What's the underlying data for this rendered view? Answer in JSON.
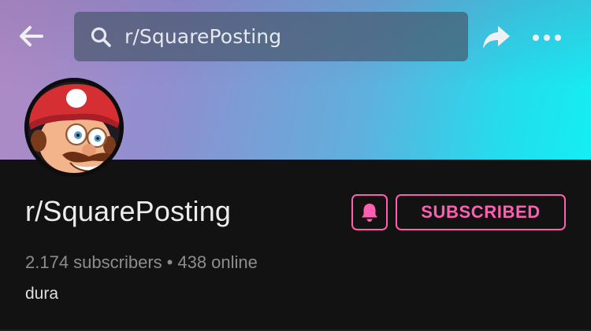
{
  "header": {
    "search": {
      "value": "r/SquarePosting"
    },
    "icons": {
      "back": "back-arrow-icon",
      "search": "search-icon",
      "share": "share-icon",
      "more": "more-options-icon"
    }
  },
  "community": {
    "name": "r/SquarePosting",
    "subscribers": "2.174 subscribers",
    "separator": "•",
    "online": "438 online",
    "description": "dura",
    "subscribed_label": "SUBSCRIBED",
    "bell_icon": "bell-icon"
  },
  "colors": {
    "accent": "#ff5fb0",
    "background": "#121212",
    "banner_start": "#b08ac4",
    "banner_end": "#14eef3"
  }
}
